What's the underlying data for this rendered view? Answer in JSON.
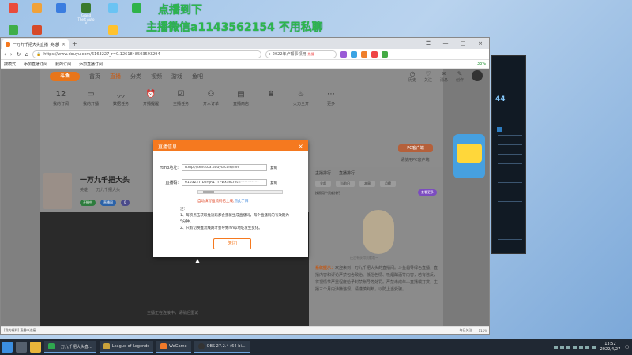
{
  "overlay": {
    "line1": "点播到下",
    "line2": "主播微信a1143562154 不用私聊"
  },
  "desktop_icons": [
    {
      "label": "",
      "color": "#e94b3c"
    },
    {
      "label": "",
      "color": "#f0a23a"
    },
    {
      "label": "",
      "color": "#3a7de0"
    },
    {
      "label": "Grand Theft Auto V",
      "color": "#3b7a2e"
    },
    {
      "label": "",
      "color": "#6ac3f3"
    },
    {
      "label": "",
      "color": "#2fb34a"
    }
  ],
  "browser": {
    "tab_title": "一万九千把大头直播_英雄联盟直播",
    "new_tab": "+",
    "url": "https://www.douyu.com/6163227_r=0.1261848503593294",
    "search_text": "2022年卢帮事领用",
    "search_hot": "热搜",
    "bookmarks": [
      "搜模式",
      "添加直播订阅",
      "我的订阅",
      "添加直播订阅"
    ],
    "zoom_status": "33%"
  },
  "site": {
    "logo": "斗鱼",
    "nav": [
      "首页",
      "直播",
      "分类",
      "视频",
      "游戏",
      "鱼吧"
    ],
    "header_right": [
      "历史",
      "关注",
      "消息",
      "创作"
    ],
    "icon_row": [
      {
        "label": "12\n我的订阅",
        "icon": "12"
      },
      {
        "label": "我的开播",
        "icon": "▭"
      },
      {
        "label": "数据任务",
        "icon": "〰"
      },
      {
        "label": "开播提醒",
        "icon": "⏰"
      },
      {
        "label": "主播任务",
        "icon": "☑"
      },
      {
        "label": "开人订单",
        "icon": "⚇"
      },
      {
        "label": "直播商店",
        "icon": "▤"
      },
      {
        "label": "",
        "icon": "♛"
      },
      {
        "label": "火力全开",
        "icon": "♨"
      },
      {
        "label": "更多",
        "icon": "⋯"
      }
    ],
    "pc_button": "PC客户端",
    "pc_text": "请使用PC客户端",
    "streamer_name": "一万九千把大头",
    "streamer_line": [
      "英雄",
      "一万九千把大头"
    ],
    "badges": [
      "开播中",
      "直播间",
      "0"
    ],
    "player_msg": "主播正在连接中，请稍后重试",
    "right_tabs": [
      "主播排行",
      "直播排行"
    ],
    "right_sub": [
      "全部",
      "当前日",
      "本周",
      "月榜"
    ],
    "rank_text": "按照用户贡献排行",
    "rank_btn": "查看更多",
    "mascot_cap": "还没有获得贡献哦~",
    "sys_label": "系统提示：",
    "sys_msg": "欢迎来到一万九千把大头的直播间。斗鱼倡导绿色直播，直播内容和评论严禁包含政治、低俗色情、吸烟酗酒等内容，若有违反，将视情节严重程度给予封禁账号等处罚。严禁未成年人直播或打赏，主播三个月内涉嫌违规，请谨慎判断，以防上当受骗。",
    "status_left": "[我的福利] 直播中连接...",
    "status_right": [
      "每日关注",
      "115%"
    ]
  },
  "modal": {
    "title": "直播信息",
    "rtmp_label": "rtmp地址:",
    "rtmp_value": "rtmp://sendtc3.douyu.com/live",
    "key_label": "直播码:",
    "key_value": "6163227rbvHjR1TY7wxSecret=**********",
    "copy": "复制",
    "auto_note": "自动填写推流码已上线,",
    "auto_link": "点此了解",
    "notes_title": "注:",
    "note1": "1、每次点击获取推流码都会重新生成直播码，每个直播码的有效期为5分钟。",
    "note2": "2、只有切换推流线路才会导致rtmp地址发生变化。",
    "ok": "关闭"
  },
  "obs": {
    "num": "44"
  },
  "taskbar": {
    "items": [
      "一万九千把大头直...",
      "League of Legends",
      "WeGame",
      "OBS 27.2.4 (64-bi..."
    ],
    "time": "13:52",
    "date": "2022/4/27"
  },
  "colors": {
    "accent": "#f5791f",
    "overlay": "#2db84b"
  }
}
